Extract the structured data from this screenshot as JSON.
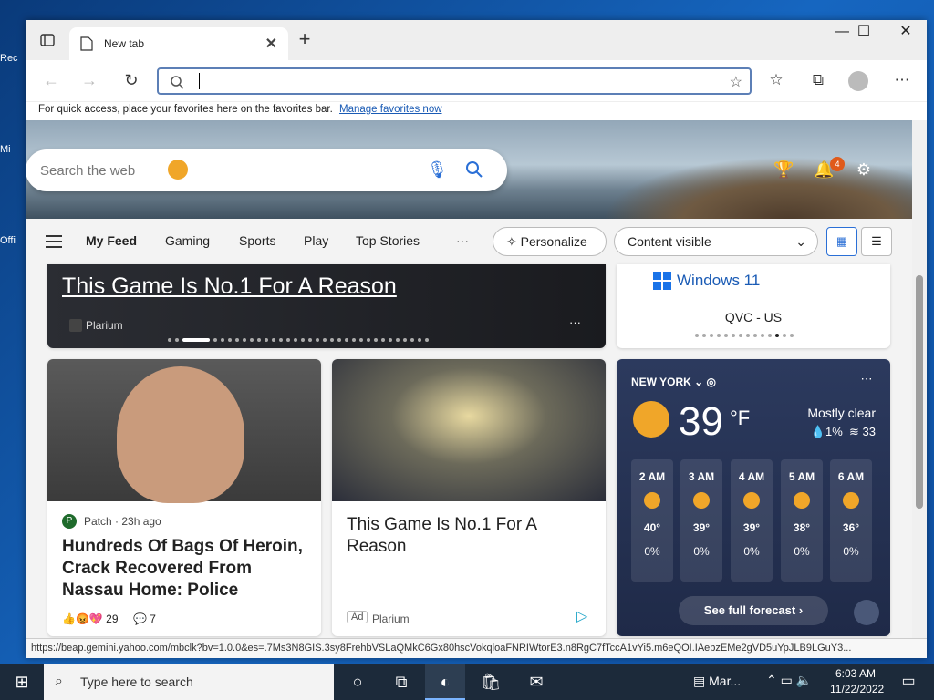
{
  "desktop": {
    "icons": [
      "Rec",
      "Mi",
      "Offi"
    ]
  },
  "tab": {
    "title": "New tab"
  },
  "favbar": {
    "text": "For quick access, place your favorites here on the favorites bar.",
    "link": "Manage favorites now"
  },
  "search": {
    "placeholder": "Search the web"
  },
  "notifications": {
    "count": "4"
  },
  "feed": {
    "items": [
      "My Feed",
      "Gaming",
      "Sports",
      "Play",
      "Top Stories"
    ],
    "more": "···",
    "personalize": "Personalize",
    "content_visible": "Content visible"
  },
  "hero_card": {
    "title": "This Game Is No.1 For A Reason",
    "source": "Plarium",
    "more": "···"
  },
  "ad_card_top": {
    "brand": "Windows 11",
    "source": "QVC - US"
  },
  "news_card": {
    "source": "Patch · 23h ago",
    "title": "Hundreds Of Bags Of Heroin, Crack Recovered From Nassau Home: Police",
    "reactions": "29",
    "comments": "7"
  },
  "game_card": {
    "title": "This Game Is No.1 For A Reason",
    "ad": "Ad",
    "source": "Plarium"
  },
  "weather": {
    "city": "NEW YORK",
    "temp": "39",
    "unit": "°F",
    "condition": "Mostly clear",
    "precip": "1%",
    "aqi": "33",
    "cta": "See full forecast",
    "hours": [
      {
        "time": "2 AM",
        "temp": "40°",
        "pct": "0%"
      },
      {
        "time": "3 AM",
        "temp": "39°",
        "pct": "0%"
      },
      {
        "time": "4 AM",
        "temp": "39°",
        "pct": "0%"
      },
      {
        "time": "5 AM",
        "temp": "38°",
        "pct": "0%"
      },
      {
        "time": "6 AM",
        "temp": "36°",
        "pct": "0%"
      }
    ]
  },
  "status": {
    "url": "https://beap.gemini.yahoo.com/mbclk?bv=1.0.0&es=.7Ms3N8GIS.3sy8FrehbVSLaQMkC6Gx80hscVokqloaFNRIWtorE3.n8RgC7fTccA1vYi5.m6eQOI.IAebzEMe2gVD5uYpJLB9LGuY3..."
  },
  "taskbar": {
    "search": "Type here to search",
    "weather": "Mar...",
    "time": "6:03 AM",
    "date": "11/22/2022"
  }
}
